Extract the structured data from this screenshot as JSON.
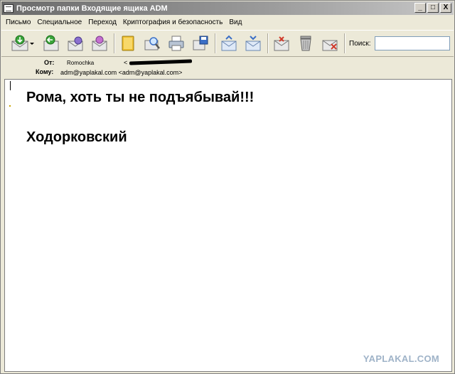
{
  "window": {
    "title": "Просмотр папки Входящие ящика ADM",
    "minimize_glyph": "_",
    "maximize_glyph": "□",
    "close_glyph": "X"
  },
  "menu": {
    "items": [
      "Письмо",
      "Специальное",
      "Переход",
      "Криптография и безопасность",
      "Вид"
    ]
  },
  "toolbar": {
    "buttons": [
      "get-mail-icon",
      "dropdown-arrow-icon",
      "reply-icon",
      "reply-all-icon",
      "forward-icon",
      "address-book-icon",
      "find-icon",
      "print-icon",
      "save-icon",
      "previous-message-icon",
      "next-message-icon",
      "mark-unread-icon",
      "delete-icon",
      "junk-icon"
    ],
    "search_label": "Поиск:",
    "search_value": ""
  },
  "headers": {
    "from_label": "От:",
    "from_name": "Romochka",
    "from_address_open": "<",
    "to_label": "Кому:",
    "to_value": "adm@yaplakal.com <adm@yaplakal.com>"
  },
  "message": {
    "line1": "Рома, хоть ты не подъябывай!!!",
    "line2": "Ходорковский"
  },
  "watermark": "YAPLAKAL.COM",
  "colors": {
    "toolbar_green": "#3aa53a",
    "toolbar_blue": "#3b6fc6",
    "watermark": "#9fb3c8"
  }
}
